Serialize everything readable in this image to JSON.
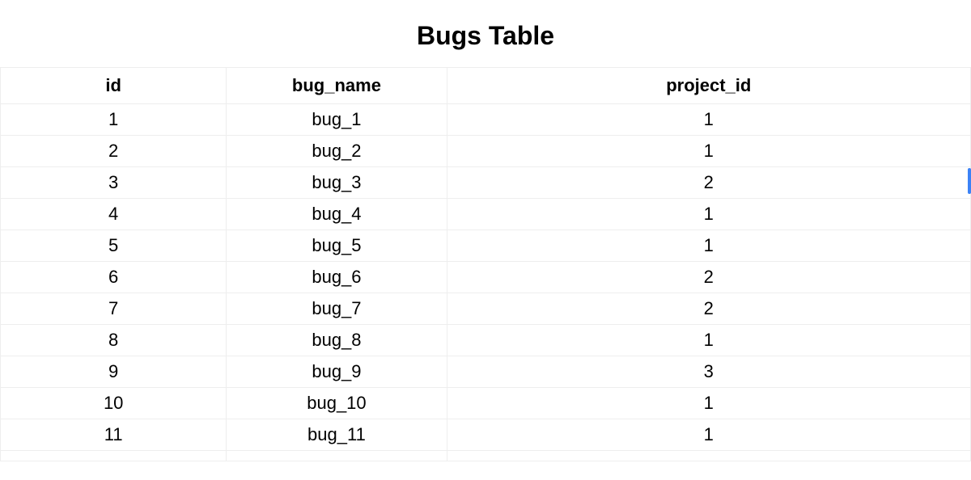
{
  "title": "Bugs Table",
  "columns": [
    "id",
    "bug_name",
    "project_id"
  ],
  "rows": [
    {
      "id": "1",
      "bug_name": "bug_1",
      "project_id": "1"
    },
    {
      "id": "2",
      "bug_name": "bug_2",
      "project_id": "1"
    },
    {
      "id": "3",
      "bug_name": "bug_3",
      "project_id": "2"
    },
    {
      "id": "4",
      "bug_name": "bug_4",
      "project_id": "1"
    },
    {
      "id": "5",
      "bug_name": "bug_5",
      "project_id": "1"
    },
    {
      "id": "6",
      "bug_name": "bug_6",
      "project_id": "2"
    },
    {
      "id": "7",
      "bug_name": "bug_7",
      "project_id": "2"
    },
    {
      "id": "8",
      "bug_name": "bug_8",
      "project_id": "1"
    },
    {
      "id": "9",
      "bug_name": "bug_9",
      "project_id": "3"
    },
    {
      "id": "10",
      "bug_name": "bug_10",
      "project_id": "1"
    },
    {
      "id": "11",
      "bug_name": "bug_11",
      "project_id": "1"
    }
  ],
  "chart_data": {
    "type": "table",
    "title": "Bugs Table",
    "columns": [
      "id",
      "bug_name",
      "project_id"
    ],
    "rows": [
      [
        1,
        "bug_1",
        1
      ],
      [
        2,
        "bug_2",
        1
      ],
      [
        3,
        "bug_3",
        2
      ],
      [
        4,
        "bug_4",
        1
      ],
      [
        5,
        "bug_5",
        1
      ],
      [
        6,
        "bug_6",
        2
      ],
      [
        7,
        "bug_7",
        2
      ],
      [
        8,
        "bug_8",
        1
      ],
      [
        9,
        "bug_9",
        3
      ],
      [
        10,
        "bug_10",
        1
      ],
      [
        11,
        "bug_11",
        1
      ]
    ]
  }
}
